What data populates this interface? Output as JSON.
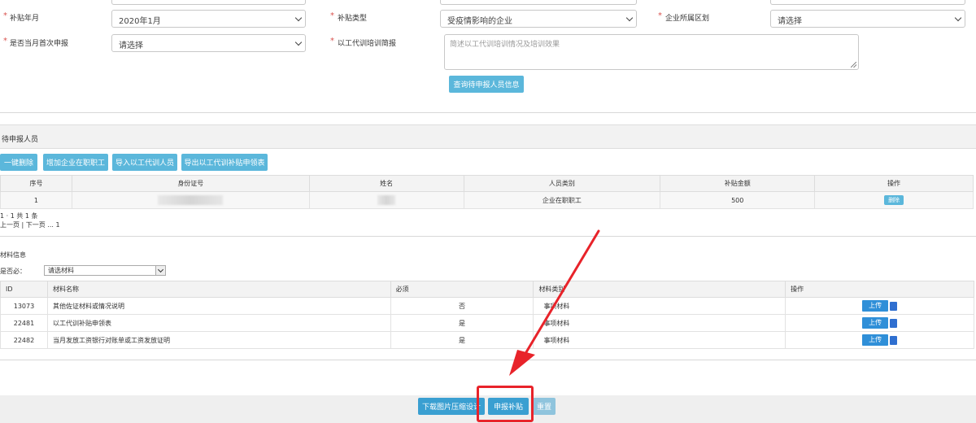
{
  "form": {
    "row1": {
      "label1": "补贴年月",
      "value1": "2020年1月",
      "label2": "补贴类型",
      "value2": "受疫情影响的企业",
      "label3": "企业所属区划",
      "value3": "请选择"
    },
    "row2": {
      "label1": "是否当月首次申报",
      "value1": "请选择",
      "label2": "以工代训培训简报",
      "placeholder2": "简述以工代训培训情况及培训效果"
    },
    "query_button": "查询待申报人员信息"
  },
  "staff": {
    "section_title": "待申报人员",
    "toolbar": {
      "btn1": "一键删除",
      "btn2": "增加企业在职职工",
      "btn3": "导入以工代训人员",
      "btn4": "导出以工代训补贴申领表"
    },
    "columns": [
      "序号",
      "身份证号",
      "姓名",
      "人员类别",
      "补贴金额",
      "操作"
    ],
    "rows": [
      {
        "index": "1",
        "category": "企业在职职工",
        "amount": "500",
        "action": "删除"
      }
    ],
    "pager_line1": "1 · 1 共 1 条",
    "pager_line2": "上一页 | 下一页 ... 1"
  },
  "materials": {
    "section_title": "材料信息",
    "filter_label": "是否必：",
    "filter_value": "请选材料",
    "columns": [
      "ID",
      "材料名称",
      "必须",
      "材料类别",
      "操作"
    ],
    "rows": [
      {
        "id": "13073",
        "name": "其他佐证材料或情况说明",
        "required": "否",
        "category": "事项材料",
        "action": "上传"
      },
      {
        "id": "22481",
        "name": "以工代训补贴申领表",
        "required": "是",
        "category": "事项材料",
        "action": "上传"
      },
      {
        "id": "22482",
        "name": "当月发放工资银行对账单或工资发放证明",
        "required": "是",
        "category": "事项材料",
        "action": "上传"
      }
    ]
  },
  "footer": {
    "btn_download": "下载图片压缩设计",
    "btn_submit": "申报补贴",
    "btn_reset": "重置"
  },
  "colors": {
    "accent": "#5bb7db",
    "upload": "#2f8fd8",
    "highlight": "#e8232a",
    "required_star": "#d9534f"
  }
}
